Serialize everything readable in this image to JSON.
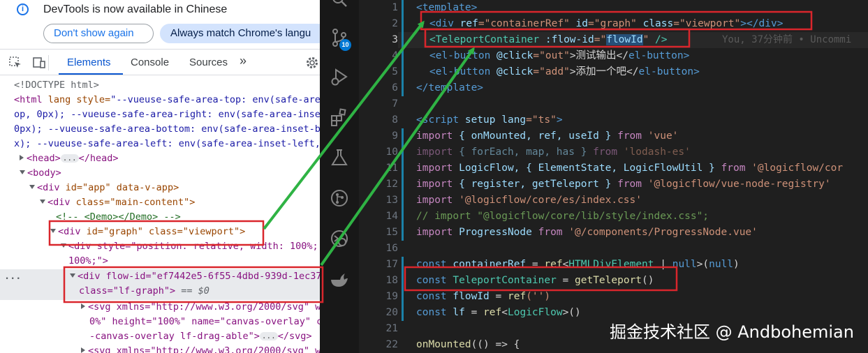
{
  "devtools": {
    "banner": {
      "message": "DevTools is now available in Chinese",
      "dont_show": "Don't show again",
      "always_match": "Always match Chrome's langu"
    },
    "tabs": [
      "Elements",
      "Console",
      "Sources"
    ],
    "more_tabs": "»",
    "dom": {
      "doctype": "<!DOCTYPE html>",
      "html_open": "<html",
      "html_attr": " lang style=",
      "html_style_1": "\"--vueuse-safe-area-top: env(safe-area",
      "html_style_2": "op, 0px); --vueuse-safe-area-right: env(safe-area-inset",
      "html_style_3": "0px); --vueuse-safe-area-bottom: env(safe-area-inset-bo",
      "html_style_4": "x); --vueuse-safe-area-left: env(safe-area-inset-left,",
      "head": "<head>",
      "head_close": "</head>",
      "body": "<body>",
      "app_div_tag": "<div ",
      "app_div_attrs": "id=\"app\" data-v-app>",
      "main_div_tag": "<div ",
      "main_div_attrs": "class=\"main-content\">",
      "comment": "<!-- <Demo></Demo> -->",
      "graph_div_tag": "<div ",
      "graph_div_attrs": "id=\"graph\" class=\"viewport\">",
      "style_div": "<div style=\"position: relative; width: 100%;",
      "style_div_2": "100%;\">",
      "flow_div": "<div flow-id=\"ef7442e5-6f55-4dbd-939d-1ec37",
      "flow_div_2": "class=\"lf-graph\">",
      "dollar": " == $0",
      "svg1": "<svg xmlns=\"http://www.w3.org/2000/svg\" w",
      "svg1_b": "0%\" height=\"100%\" name=\"canvas-overlay\" c",
      "svg1_c": "-canvas-overlay lf-drag-able\">",
      "svg1_close": "</svg>",
      "svg2": "<svg xmlns=\"http://www.w3.org/2000/svg\" w",
      "dots": "..."
    }
  },
  "editor": {
    "badge_count": "10",
    "blame": "You, 37分钟前 • Uncommi",
    "line_numbers": [
      "1",
      "2",
      "3",
      "4",
      "5",
      "6",
      "7",
      "8",
      "9",
      "10",
      "11",
      "12",
      "13",
      "14",
      "15",
      "16",
      "17",
      "18",
      "19",
      "20",
      "21",
      "22"
    ],
    "lines": {
      "l1": "<template>",
      "l2a": "<div ",
      "l2b": "ref",
      "l2c": "=\"containerRef\" ",
      "l2d": "id",
      "l2e": "=\"graph\" ",
      "l2f": "class",
      "l2g": "=\"viewport\"",
      "l2h": "></",
      "l2i": "div",
      "l2j": ">",
      "l3a": "<TeleportContainer ",
      "l3b": ":flow-id",
      "l3c": "=\"",
      "l3d": "flowId",
      "l3e": "\"",
      "l3f": " />",
      "l4a": "<el-button ",
      "l4b": "@click",
      "l4c": "=\"out\"",
      "l4d": ">测试输出</",
      "l4e": "el-button",
      "l4f": ">",
      "l5a": "<el-button ",
      "l5b": "@click",
      "l5c": "=\"add\"",
      "l5d": ">添加一个吧</",
      "l5e": "el-button",
      "l5f": ">",
      "l6": "</template>",
      "l8a": "<script ",
      "l8b": "setup ",
      "l8c": "lang",
      "l8d": "=\"ts\"",
      "l8e": ">",
      "l9a": "import ",
      "l9b": "{ onMounted, ref, useId } ",
      "l9c": "from ",
      "l9d": "'vue'",
      "l10a": "import ",
      "l10b": "{ forEach, map, has } ",
      "l10c": "from ",
      "l10d": "'lodash-es'",
      "l11a": "import ",
      "l11b": "LogicFlow, { ElementState, LogicFlowUtil } ",
      "l11c": "from ",
      "l11d": "'@logicflow/cor",
      "l12a": "import ",
      "l12b": "{ register, getTeleport } ",
      "l12c": "from ",
      "l12d": "'@logicflow/vue-node-registry'",
      "l13a": "import ",
      "l13b": "'@logicflow/core/es/index.css'",
      "l14": "// import \"@logicflow/core/lib/style/index.css\";",
      "l15a": "import ",
      "l15b": "ProgressNode ",
      "l15c": "from ",
      "l15d": "'@/components/ProgressNode.vue'",
      "l17a": "const ",
      "l17b": "containerRef",
      "l17c": " = ",
      "l17d": "ref",
      "l17e": "<",
      "l17f": "HTMLDivElement",
      "l17g": " | ",
      "l17h": "null",
      "l17i": ">(",
      "l17j": "null",
      "l17k": ")",
      "l18a": "const ",
      "l18b": "TeleportContainer",
      "l18c": " = ",
      "l18d": "getTeleport",
      "l18e": "()",
      "l19a": "const ",
      "l19b": "flowId",
      "l19c": " = ",
      "l19d": "ref",
      "l19e": "('')",
      "l20a": "const ",
      "l20b": "lf",
      "l20c": " = ",
      "l20d": "ref",
      "l20e": "<",
      "l20f": "LogicFlow",
      "l20g": ">()",
      "l22a": "onMounted",
      "l22b": "(() => {"
    },
    "watermark": "掘金技术社区 @ Andbohemian"
  },
  "colors": {
    "annotation_red": "#d9262c",
    "arrow_green": "#2fb344"
  }
}
